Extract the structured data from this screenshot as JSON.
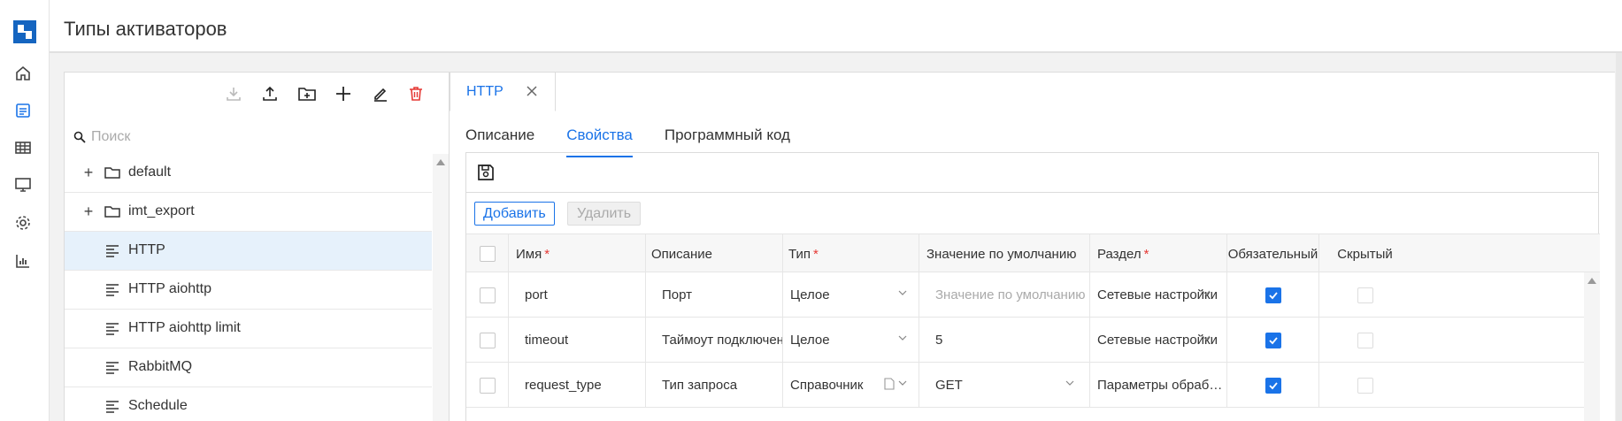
{
  "header": {
    "title": "Типы активаторов"
  },
  "rail": {
    "items": [
      {
        "icon": "home-icon"
      },
      {
        "icon": "activator-types-icon"
      },
      {
        "icon": "table-icon"
      },
      {
        "icon": "monitor-icon"
      },
      {
        "icon": "settings-icon"
      },
      {
        "icon": "bar-chart-icon"
      }
    ]
  },
  "left_toolbar": {
    "icons": [
      "download-icon",
      "upload-icon",
      "new-folder-icon",
      "add-icon",
      "edit-icon",
      "delete-icon"
    ]
  },
  "search": {
    "placeholder": "Поиск"
  },
  "tree": {
    "items": [
      {
        "label": "default",
        "kind": "folder",
        "expandable": true
      },
      {
        "label": "imt_export",
        "kind": "folder",
        "expandable": true
      },
      {
        "label": "HTTP",
        "kind": "item",
        "selected": true
      },
      {
        "label": "HTTP aiohttp",
        "kind": "item"
      },
      {
        "label": "HTTP aiohttp limit",
        "kind": "item"
      },
      {
        "label": "RabbitMQ",
        "kind": "item"
      },
      {
        "label": "Schedule",
        "kind": "item"
      }
    ]
  },
  "doc_tab": {
    "label": "HTTP"
  },
  "subtabs": [
    {
      "label": "Описание",
      "active": false
    },
    {
      "label": "Свойства",
      "active": true
    },
    {
      "label": "Программный код",
      "active": false
    }
  ],
  "actions": {
    "add": "Добавить",
    "delete": "Удалить"
  },
  "table": {
    "columns": [
      {
        "label": "Имя",
        "required": true
      },
      {
        "label": "Описание",
        "required": false
      },
      {
        "label": "Тип",
        "required": true
      },
      {
        "label": "Значение по умолчанию",
        "required": false
      },
      {
        "label": "Раздел",
        "required": true
      },
      {
        "label": "Обязательный",
        "required": false
      },
      {
        "label": "Скрытый",
        "required": false
      }
    ],
    "rows": [
      {
        "name": "port",
        "description": "Порт",
        "type": "Целое",
        "default": "",
        "default_placeholder": "Значение по умолчанию",
        "section": "Сетевые настройки",
        "required": true,
        "hidden": false
      },
      {
        "name": "timeout",
        "description": "Таймоут подключен",
        "type": "Целое",
        "default": "5",
        "default_placeholder": "",
        "section": "Сетевые настройки",
        "required": true,
        "hidden": false
      },
      {
        "name": "request_type",
        "description": "Тип запроса",
        "type": "Справочник",
        "default": "GET",
        "default_placeholder": "",
        "section": "Параметры обраб…",
        "required": true,
        "hidden": false
      }
    ]
  },
  "colors": {
    "accent": "#1a73e8",
    "danger": "#e53935",
    "logo": "#1565c0"
  }
}
